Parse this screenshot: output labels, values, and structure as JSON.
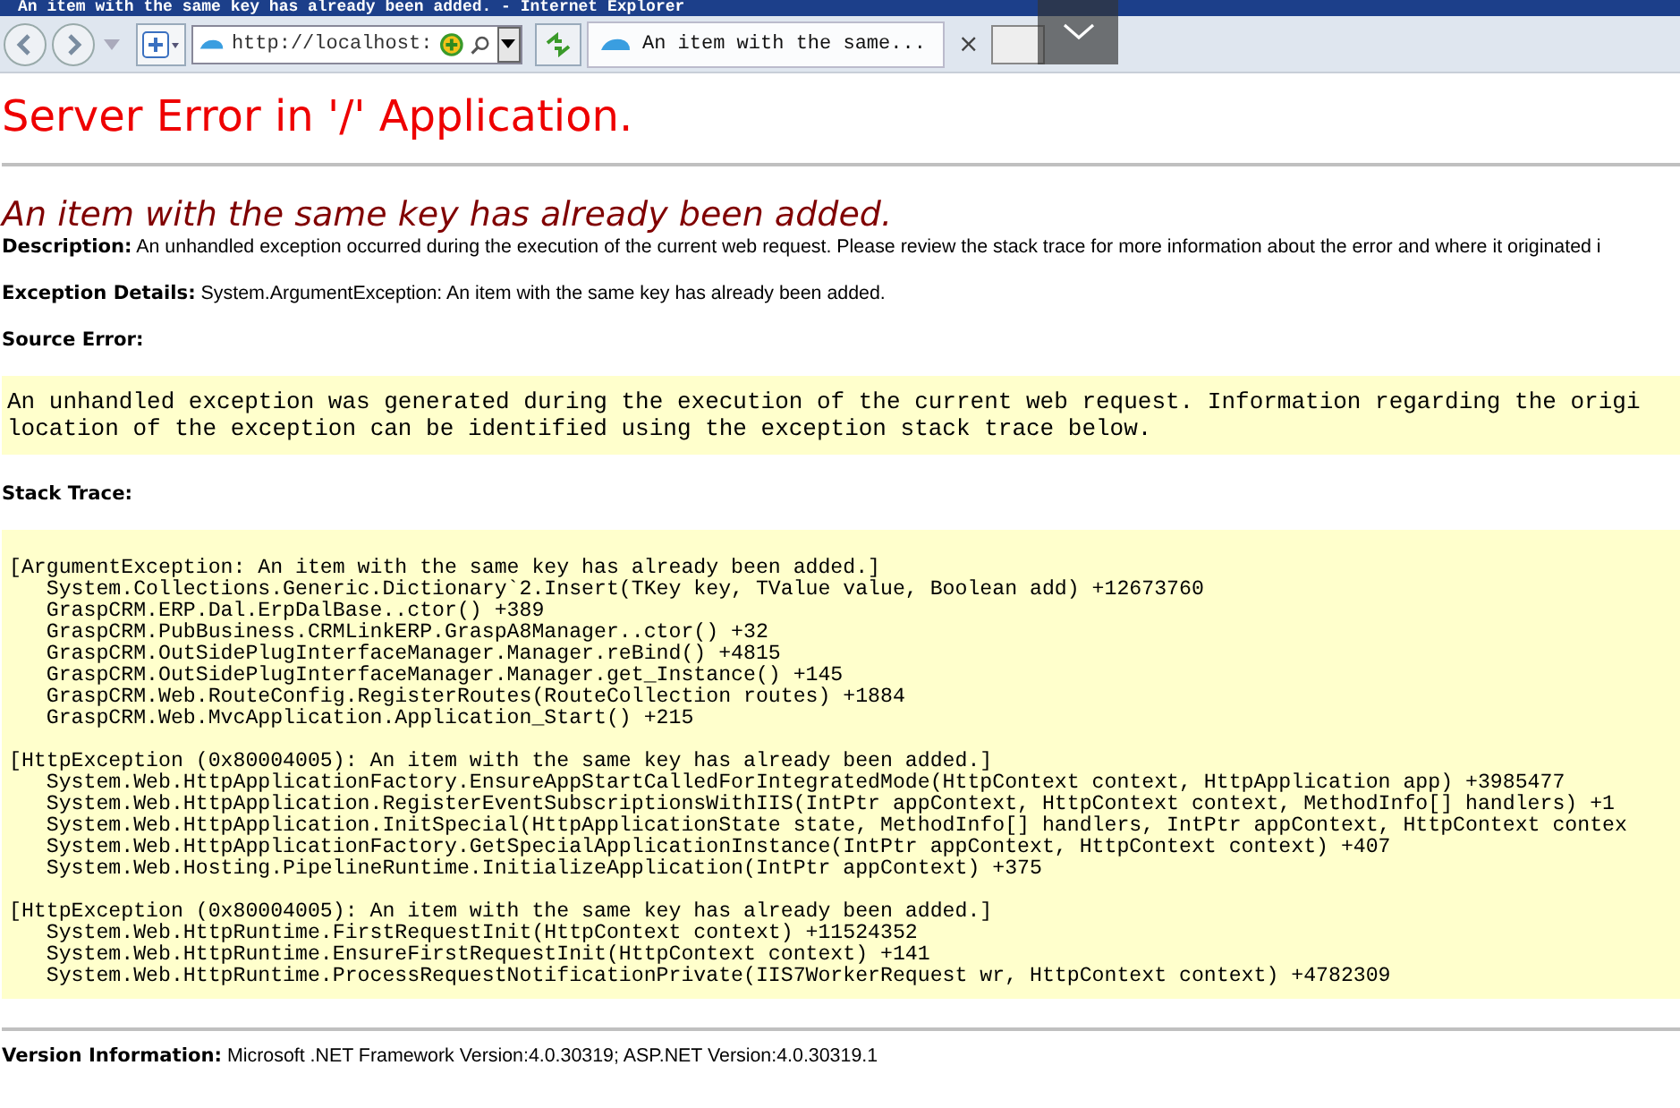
{
  "window": {
    "title": "An item with the same key has already been added. - Internet Explorer"
  },
  "toolbar": {
    "address": "http://localhost:",
    "tab": {
      "label": "An item with the same...",
      "selected": true
    },
    "close_glyph": "×"
  },
  "page": {
    "heading": "Server Error in '/' Application.",
    "error_title": "An item with the same key has already been added.",
    "sections": [
      {
        "kind": "field",
        "label": "Description:",
        "text": "An unhandled exception occurred during the execution of the current web request. Please review the stack trace for more information about the error and where it originated i"
      },
      {
        "kind": "field",
        "label": "Exception Details:",
        "text": "System.ArgumentException: An item with the same key has already been added."
      },
      {
        "kind": "heading",
        "label": "Source Error:"
      },
      {
        "kind": "box",
        "lines": [
          "An unhandled exception was generated during the execution of the current web request. Information regarding the origi",
          "location of the exception can be identified using the exception stack trace below."
        ]
      },
      {
        "kind": "heading",
        "label": "Stack Trace:"
      },
      {
        "kind": "trace",
        "groups": [
          {
            "lines": [
              "[ArgumentException: An item with the same key has already been added.]",
              "   System.Collections.Generic.Dictionary`2.Insert(TKey key, TValue value, Boolean add) +12673760",
              "   GraspCRM.ERP.Dal.ErpDalBase..ctor() +389",
              "   GraspCRM.PubBusiness.CRMLinkERP.GraspA8Manager..ctor() +32",
              "   GraspCRM.OutSidePlugInterfaceManager.Manager.reBind() +4815",
              "   GraspCRM.OutSidePlugInterfaceManager.Manager.get_Instance() +145",
              "   GraspCRM.Web.RouteConfig.RegisterRoutes(RouteCollection routes) +1884",
              "   GraspCRM.Web.MvcApplication.Application_Start() +215"
            ]
          },
          {
            "lines": [
              "[HttpException (0x80004005): An item with the same key has already been added.]",
              "   System.Web.HttpApplicationFactory.EnsureAppStartCalledForIntegratedMode(HttpContext context, HttpApplication app) +3985477",
              "   System.Web.HttpApplication.RegisterEventSubscriptionsWithIIS(IntPtr appContext, HttpContext context, MethodInfo[] handlers) +1",
              "   System.Web.HttpApplication.InitSpecial(HttpApplicationState state, MethodInfo[] handlers, IntPtr appContext, HttpContext contex",
              "   System.Web.HttpApplicationFactory.GetSpecialApplicationInstance(IntPtr appContext, HttpContext context) +407",
              "   System.Web.Hosting.PipelineRuntime.InitializeApplication(IntPtr appContext) +375"
            ]
          },
          {
            "lines": [
              "[HttpException (0x80004005): An item with the same key has already been added.]",
              "   System.Web.HttpRuntime.FirstRequestInit(HttpContext context) +11524352",
              "   System.Web.HttpRuntime.EnsureFirstRequestInit(HttpContext context) +141",
              "   System.Web.HttpRuntime.ProcessRequestNotificationPrivate(IIS7WorkerRequest wr, HttpContext context) +4782309"
            ]
          }
        ]
      },
      {
        "kind": "version",
        "label": "Version Information:",
        "text": "Microsoft .NET Framework Version:4.0.30319; ASP.NET Version:4.0.30319.1"
      }
    ]
  }
}
